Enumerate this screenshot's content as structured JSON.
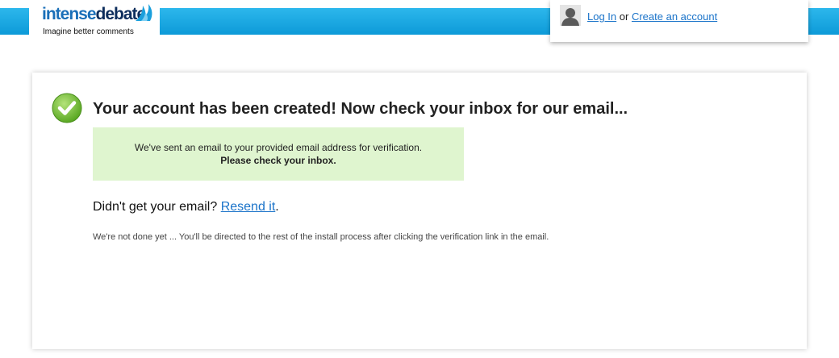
{
  "header": {
    "logo_intense": "intense",
    "logo_debate": "debate",
    "logo_tagline": "Imagine better comments",
    "accent_color": "#1a9fdc"
  },
  "account_panel": {
    "login_link": "Log In",
    "separator": " or ",
    "create_account_link": "Create an account",
    "avatar_icon": "user-silhouette-icon"
  },
  "main": {
    "status_icon": "checkmark-icon",
    "headline": "Your account has been created! Now check your inbox for our email...",
    "notice": {
      "line1": "We've sent an email to your provided email address for verification.",
      "line2": "Please check your inbox."
    },
    "resend_prompt": "Didn't get your email? ",
    "resend_link": "Resend it",
    "resend_suffix": ".",
    "footer_note": "We're not done yet ... You'll be directed to the rest of the install process after clicking the verification link in the email."
  }
}
